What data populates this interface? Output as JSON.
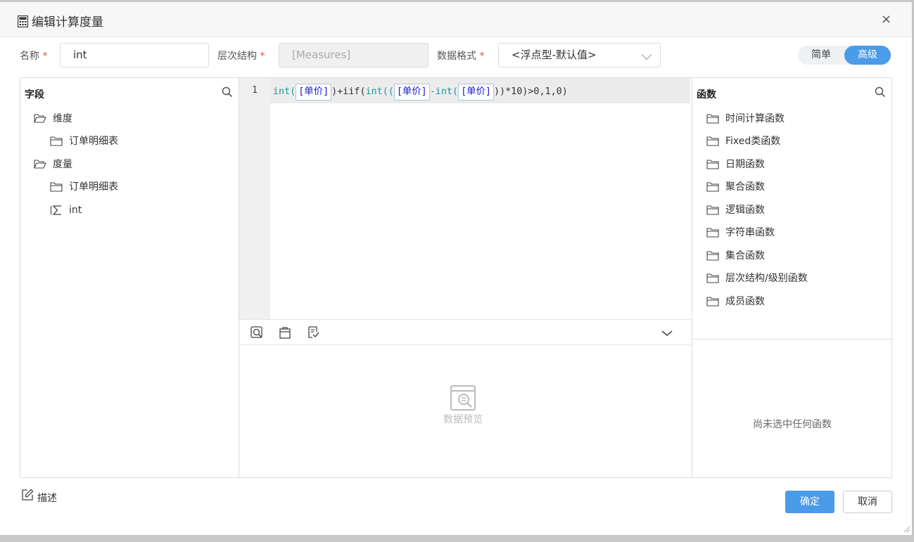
{
  "dialog": {
    "title": "编辑计算度量",
    "close_label": "×"
  },
  "form": {
    "name_label": "名称",
    "name_value": "int",
    "hierarchy_label": "层次结构",
    "hierarchy_value": "[Measures]",
    "format_label": "数据格式",
    "format_value": "<浮点型-默认值>",
    "required_mark": "*"
  },
  "mode": {
    "simple": "简单",
    "advanced": "高级",
    "selected": "高级"
  },
  "fields_panel": {
    "title": "字段",
    "items": [
      {
        "label": "维度",
        "icon": "folder-open-icon"
      },
      {
        "label": "订单明细表",
        "icon": "folder-icon"
      },
      {
        "label": "度量",
        "icon": "folder-open-icon"
      },
      {
        "label": "订单明细表",
        "icon": "folder-icon"
      },
      {
        "label": "int",
        "icon": "measure-sigma-icon"
      }
    ]
  },
  "editor": {
    "line_number": "1",
    "code": {
      "p1": "int(",
      "t1": "[单价]",
      "p2": ")+",
      "p3": "iif(",
      "p4": "int((",
      "t2": "[单价]",
      "p5": "-int(",
      "t3": "[单价]",
      "p6": "))*10)>0,1,0)"
    },
    "preview_label": "数据预览"
  },
  "functions_panel": {
    "title": "函数",
    "items": [
      "时间计算函数",
      "Fixed类函数",
      "日期函数",
      "聚合函数",
      "逻辑函数",
      "字符串函数",
      "集合函数",
      "层次结构/级别函数",
      "成员函数"
    ],
    "empty_text": "尚未选中任何函数"
  },
  "footer": {
    "describe_label": "描述",
    "ok_label": "确定",
    "cancel_label": "取消"
  },
  "colors": {
    "accent": "#4a9be8",
    "required": "#e5553b",
    "function_text": "#1a9a9a",
    "token_text": "#1a1ac8"
  }
}
